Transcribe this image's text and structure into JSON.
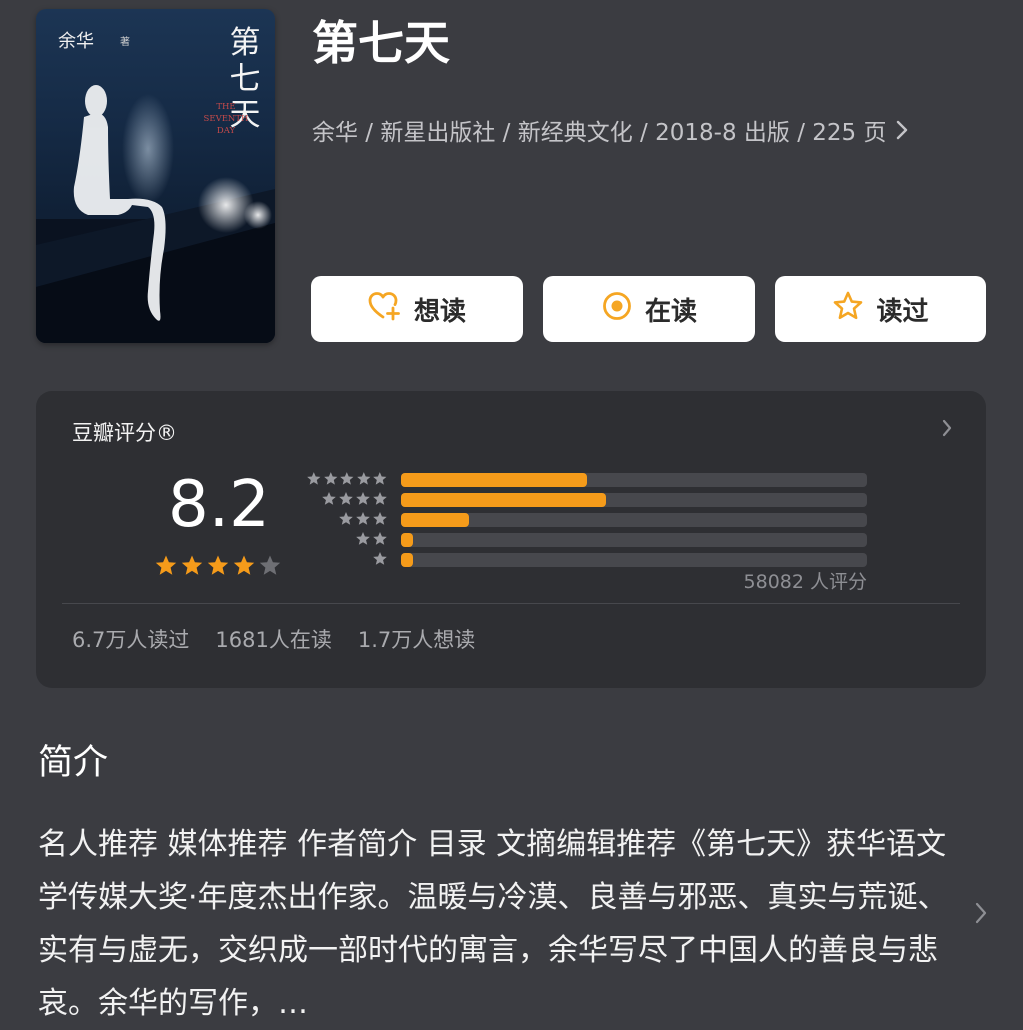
{
  "cover": {
    "author": "余华",
    "author_suffix": "著",
    "title_chars": [
      "第",
      "七",
      "天"
    ],
    "english_lines": [
      "THE",
      "SEVENTH",
      "DAY"
    ]
  },
  "book": {
    "title": "第七天",
    "meta": "余华 / 新星出版社 / 新经典文化 / 2018-8 出版 / 225 页",
    "meta_chevron_icon": "chevron-right-icon"
  },
  "actions": [
    {
      "label": "想读",
      "icon": "heart-plus-icon",
      "color": "#f5a623"
    },
    {
      "label": "在读",
      "icon": "reading-dot-icon",
      "color": "#f5a623"
    },
    {
      "label": "读过",
      "icon": "star-outline-icon",
      "color": "#f5a623"
    }
  ],
  "rating": {
    "title": "豆瓣评分®",
    "score": "8.2",
    "stars_filled": 4,
    "stars_total": 5,
    "distribution": [
      {
        "stars": 5,
        "fraction": 0.4
      },
      {
        "stars": 4,
        "fraction": 0.44
      },
      {
        "stars": 3,
        "fraction": 0.145
      },
      {
        "stars": 2,
        "fraction": 0.025
      },
      {
        "stars": 1,
        "fraction": 0.025
      }
    ],
    "count_label": "58082 人评分",
    "stats": [
      "6.7万人读过",
      "1681人在读",
      "1.7万人想读"
    ]
  },
  "intro": {
    "heading": "简介",
    "text": "名人推荐 媒体推荐 作者简介 目录 文摘编辑推荐《第七天》获华语文学传媒大奖·年度杰出作家。温暖与冷漠、良善与邪恶、真实与荒诞、实有与虚无，交织成一部时代的寓言，余华写尽了中国人的善良与悲哀。余华的写作，…"
  },
  "colors": {
    "background": "#3b3c41",
    "card": "#2e2f33",
    "accent": "#f59b1a",
    "muted_star": "#6e6f74"
  }
}
